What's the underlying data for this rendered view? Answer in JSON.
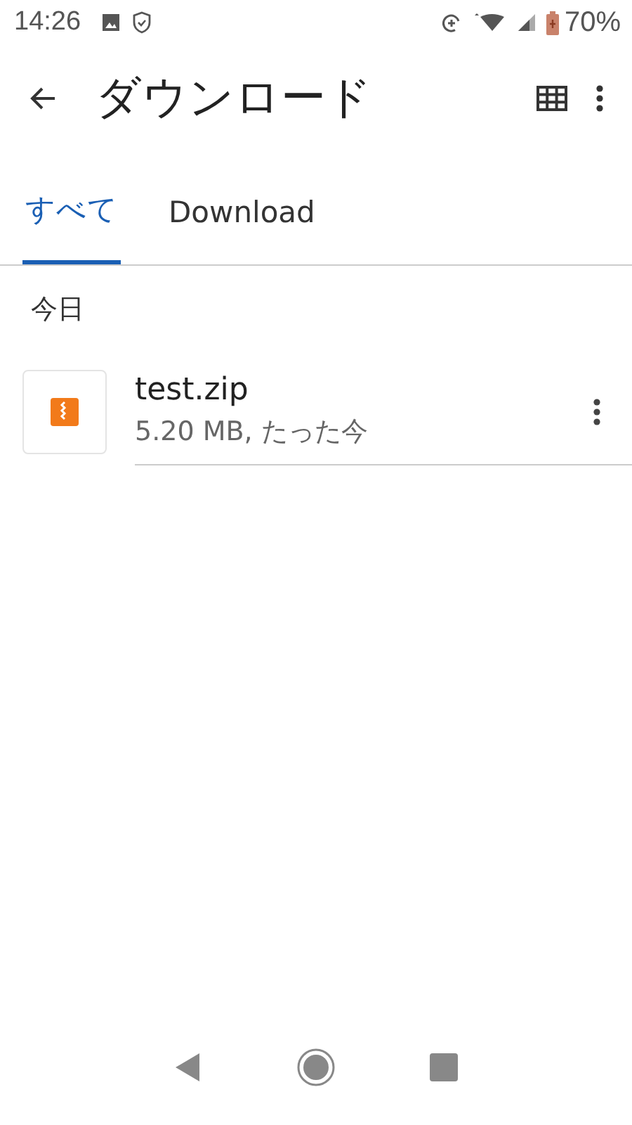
{
  "status_bar": {
    "time": "14:26",
    "battery": "70%"
  },
  "app_bar": {
    "title": "ダウンロード"
  },
  "tabs": [
    {
      "label": "すべて",
      "selected": true
    },
    {
      "label": "Download",
      "selected": false
    }
  ],
  "sections": [
    {
      "header": "今日",
      "files": [
        {
          "name": "test.zip",
          "details": "5.20 MB, たった今"
        }
      ]
    }
  ]
}
